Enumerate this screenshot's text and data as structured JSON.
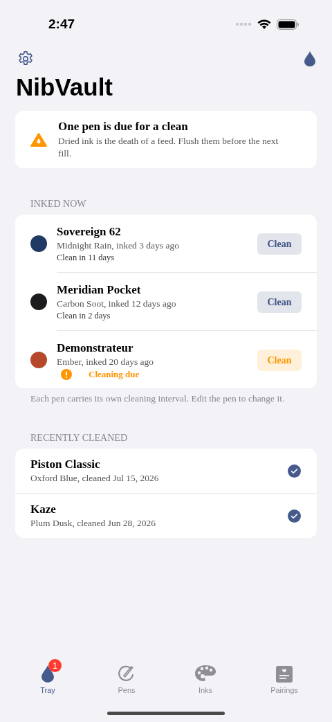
{
  "status_bar": {
    "time": "2:47"
  },
  "title": "NibVault",
  "alert": {
    "title": "One pen is due for a clean",
    "body": "Dried ink is the death of a feed. Flush them before the next fill."
  },
  "inked": {
    "header": "INKED NOW",
    "footer": "Each pen carries its own cleaning interval. Edit the pen to change it.",
    "pens": [
      {
        "name": "Sovereign 62",
        "detail": "Midnight Rain, inked 3 days ago",
        "status": "Clean in 11 days",
        "color": "#1f3a64",
        "due": false,
        "button": "Clean"
      },
      {
        "name": "Meridian Pocket",
        "detail": "Carbon Soot, inked 12 days ago",
        "status": "Clean in 2 days",
        "color": "#1c1c1e",
        "due": false,
        "button": "Clean"
      },
      {
        "name": "Demonstrateur",
        "detail": "Ember, inked 20 days ago",
        "status": "Cleaning due",
        "color": "#b5472a",
        "due": true,
        "button": "Clean"
      }
    ]
  },
  "cleaned": {
    "header": "RECENTLY CLEANED",
    "pens": [
      {
        "name": "Piston Classic",
        "detail": "Oxford Blue, cleaned Jul 15, 2026",
        "checked": true
      },
      {
        "name": "Kaze",
        "detail": "Plum Dusk, cleaned Jun 28, 2026",
        "checked": true
      }
    ]
  },
  "tabs": [
    {
      "label": "Tray",
      "kind": "drop",
      "selected": true,
      "badge": "1"
    },
    {
      "label": "Pens",
      "kind": "pen",
      "selected": false
    },
    {
      "label": "Inks",
      "kind": "palette",
      "selected": false
    },
    {
      "label": "Pairings",
      "kind": "card",
      "selected": false
    }
  ]
}
